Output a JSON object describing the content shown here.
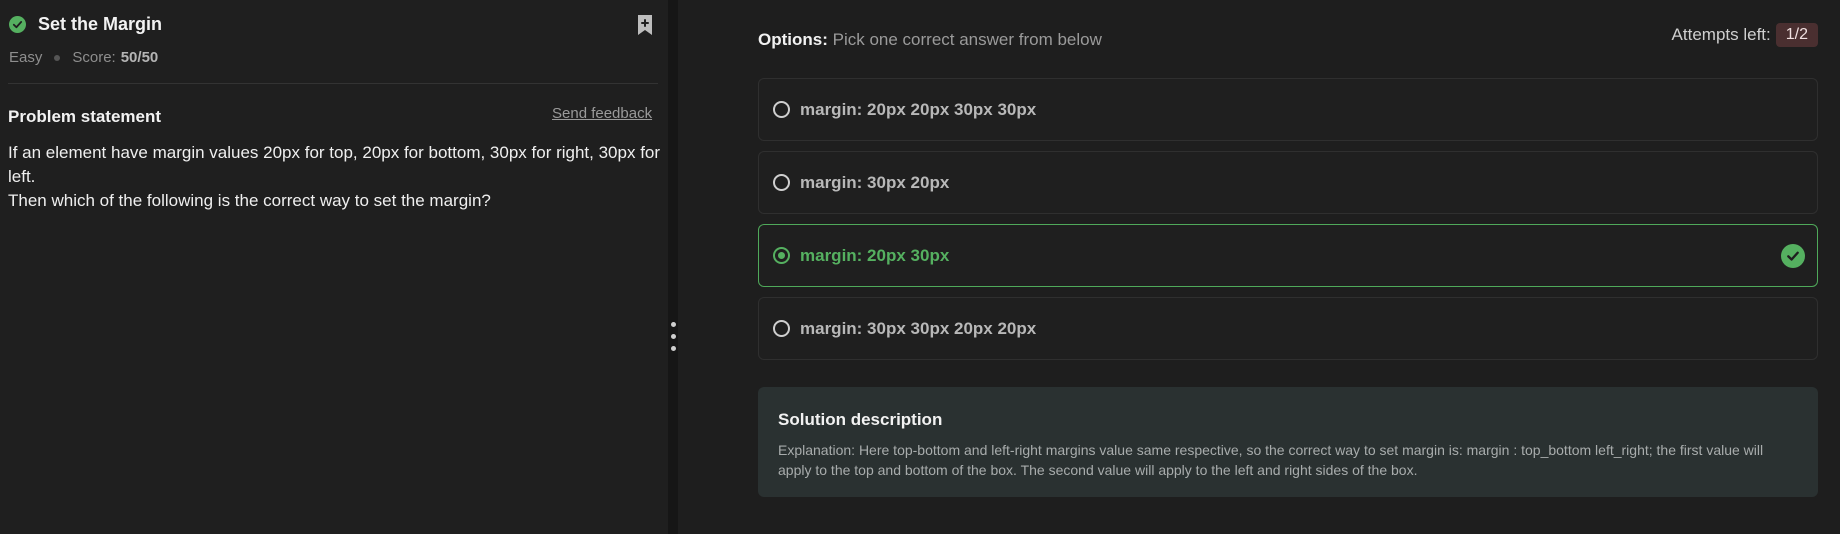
{
  "problem": {
    "title": "Set the Margin",
    "difficulty": "Easy",
    "score_label": "Score:",
    "score_value": "50/50",
    "statement_heading": "Problem statement",
    "feedback_label": "Send feedback",
    "statement_lines": [
      "If an element have margin values 20px for top, 20px for bottom, 30px for right, 30px for left.",
      "Then which of the following is the correct way to set the margin?"
    ]
  },
  "options": {
    "label": "Options:",
    "instruction": "Pick one correct answer from below",
    "attempts_label": "Attempts left:",
    "attempts_value": "1/2",
    "items": [
      {
        "text": "margin: 20px 20px 30px 30px",
        "selected": false,
        "correct": false
      },
      {
        "text": "margin: 30px 20px",
        "selected": false,
        "correct": false
      },
      {
        "text": "margin: 20px 30px",
        "selected": true,
        "correct": true
      },
      {
        "text": "margin: 30px 30px 20px 20px",
        "selected": false,
        "correct": false
      }
    ]
  },
  "solution": {
    "title": "Solution description",
    "text": "Explanation: Here top-bottom and left-right margins value same respective, so the correct way to set margin is: margin : top_bottom left_right; the first value will apply to the top and bottom of the box. The second value will apply to the left and right sides of the box."
  },
  "colors": {
    "success": "#55b060",
    "attempts_badge_bg": "#4a2f30",
    "solution_bg": "#2a3131"
  },
  "icons": {
    "solved": "check-circle-icon",
    "bookmark": "bookmark-add-icon",
    "correct_answer": "check-circle-icon"
  }
}
